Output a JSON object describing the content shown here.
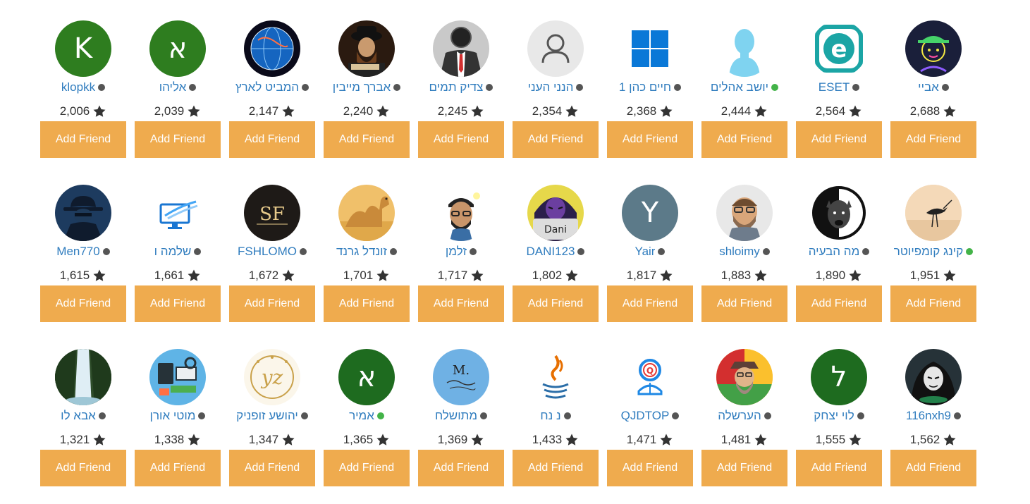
{
  "button_label": "Add Friend",
  "accent_color": "#efab4e",
  "link_color": "#2f7cbe",
  "online_color": "#43b348",
  "offline_color": "#555555",
  "users": [
    {
      "name": "klopkk",
      "score": "2,006",
      "online": false,
      "avatar": {
        "type": "letter",
        "letter": "K",
        "bg": "#2e7d1f"
      }
    },
    {
      "name": "אליהו",
      "score": "2,039",
      "online": false,
      "avatar": {
        "type": "letter",
        "letter": "א",
        "bg": "#2e7d1f"
      }
    },
    {
      "name": "המביט לארץ",
      "score": "2,147",
      "online": false,
      "avatar": {
        "type": "globe"
      }
    },
    {
      "name": "אברך מייבין",
      "score": "2,240",
      "online": false,
      "avatar": {
        "type": "rabbi"
      }
    },
    {
      "name": "צדיק תמים",
      "score": "2,245",
      "online": false,
      "avatar": {
        "type": "suit"
      }
    },
    {
      "name": "הנני העני",
      "score": "2,354",
      "online": false,
      "avatar": {
        "type": "person-outline"
      }
    },
    {
      "name": "חיים כהן 1",
      "score": "2,368",
      "online": false,
      "avatar": {
        "type": "windows"
      }
    },
    {
      "name": "יושב אהלים",
      "score": "2,444",
      "online": true,
      "avatar": {
        "type": "silhouette"
      }
    },
    {
      "name": "ESET",
      "score": "2,564",
      "online": false,
      "avatar": {
        "type": "eset"
      }
    },
    {
      "name": "אביי",
      "score": "2,688",
      "online": false,
      "avatar": {
        "type": "neon"
      }
    },
    {
      "name": "Men770",
      "score": "1,615",
      "online": false,
      "avatar": {
        "type": "spy"
      }
    },
    {
      "name": "שלמה ו",
      "score": "1,661",
      "online": false,
      "avatar": {
        "type": "monitor"
      }
    },
    {
      "name": "FSHLOMO",
      "score": "1,672",
      "online": false,
      "avatar": {
        "type": "sf",
        "text": "SF"
      }
    },
    {
      "name": "זונדל גרנד",
      "score": "1,701",
      "online": false,
      "avatar": {
        "type": "camel"
      }
    },
    {
      "name": "זלמן",
      "score": "1,717",
      "online": false,
      "avatar": {
        "type": "cartoon-man"
      }
    },
    {
      "name": "DANI123",
      "score": "1,802",
      "online": false,
      "avatar": {
        "type": "dani",
        "text": "Dani"
      }
    },
    {
      "name": "Yair",
      "score": "1,817",
      "online": false,
      "avatar": {
        "type": "letter",
        "letter": "Y",
        "bg": "#5c7a89"
      }
    },
    {
      "name": "shloimy",
      "score": "1,883",
      "online": false,
      "avatar": {
        "type": "bearded-cartoon"
      }
    },
    {
      "name": "מה הבעיה",
      "score": "1,890",
      "online": false,
      "avatar": {
        "type": "dog"
      }
    },
    {
      "name": "קינג קומפיוטר",
      "score": "1,951",
      "online": true,
      "avatar": {
        "type": "bird-sunset"
      }
    },
    {
      "name": "אבא לו",
      "score": "1,321",
      "online": false,
      "avatar": {
        "type": "waterfall"
      }
    },
    {
      "name": "מוטי אורן",
      "score": "1,338",
      "online": false,
      "avatar": {
        "type": "tech"
      }
    },
    {
      "name": "יהושע זופניק",
      "score": "1,347",
      "online": false,
      "avatar": {
        "type": "yz",
        "text": "yz"
      }
    },
    {
      "name": "אמיר",
      "score": "1,365",
      "online": true,
      "avatar": {
        "type": "letter",
        "letter": "א",
        "bg": "#1e6b1f"
      }
    },
    {
      "name": "מתושלח",
      "score": "1,369",
      "online": false,
      "avatar": {
        "type": "m-blue",
        "text": "M."
      }
    },
    {
      "name": "נ נח",
      "score": "1,433",
      "online": false,
      "avatar": {
        "type": "java"
      }
    },
    {
      "name": "QJDTOP",
      "score": "1,471",
      "online": false,
      "avatar": {
        "type": "qlogo",
        "text": "Q"
      }
    },
    {
      "name": "הערשלה",
      "score": "1,481",
      "online": false,
      "avatar": {
        "type": "colorful-man"
      }
    },
    {
      "name": "לוי יצחק",
      "score": "1,555",
      "online": false,
      "avatar": {
        "type": "letter",
        "letter": "ל",
        "bg": "#1e6b1f"
      }
    },
    {
      "name": "116nxh9",
      "score": "1,562",
      "online": false,
      "avatar": {
        "type": "hacker"
      }
    }
  ]
}
